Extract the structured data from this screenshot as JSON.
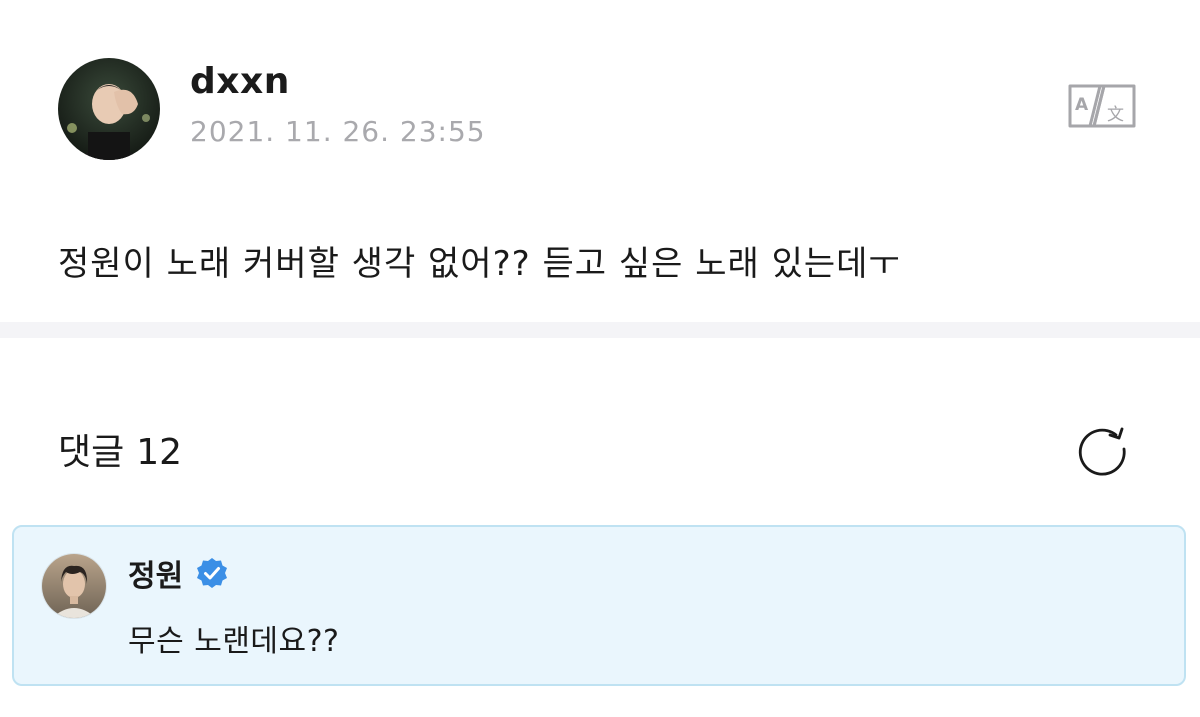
{
  "post": {
    "author": "dxxn",
    "timestamp": "2021. 11. 26. 23:55",
    "body": "정원이 노래 커버할 생각 없어?? 듣고 싶은 노래 있는데ㅜ",
    "translate_icon": "translate-icon"
  },
  "comments": {
    "title": "댓글",
    "count": "12",
    "refresh_icon": "refresh-icon",
    "items": [
      {
        "author": "정원",
        "verified": true,
        "text": "무슨 노랜데요??",
        "highlight_color": "#eaf6fd"
      }
    ]
  },
  "colors": {
    "verified_badge": "#3b8fe6",
    "timestamp": "#a9a9ad",
    "card_border": "#bfe2f2",
    "divider": "#f4f4f7"
  }
}
